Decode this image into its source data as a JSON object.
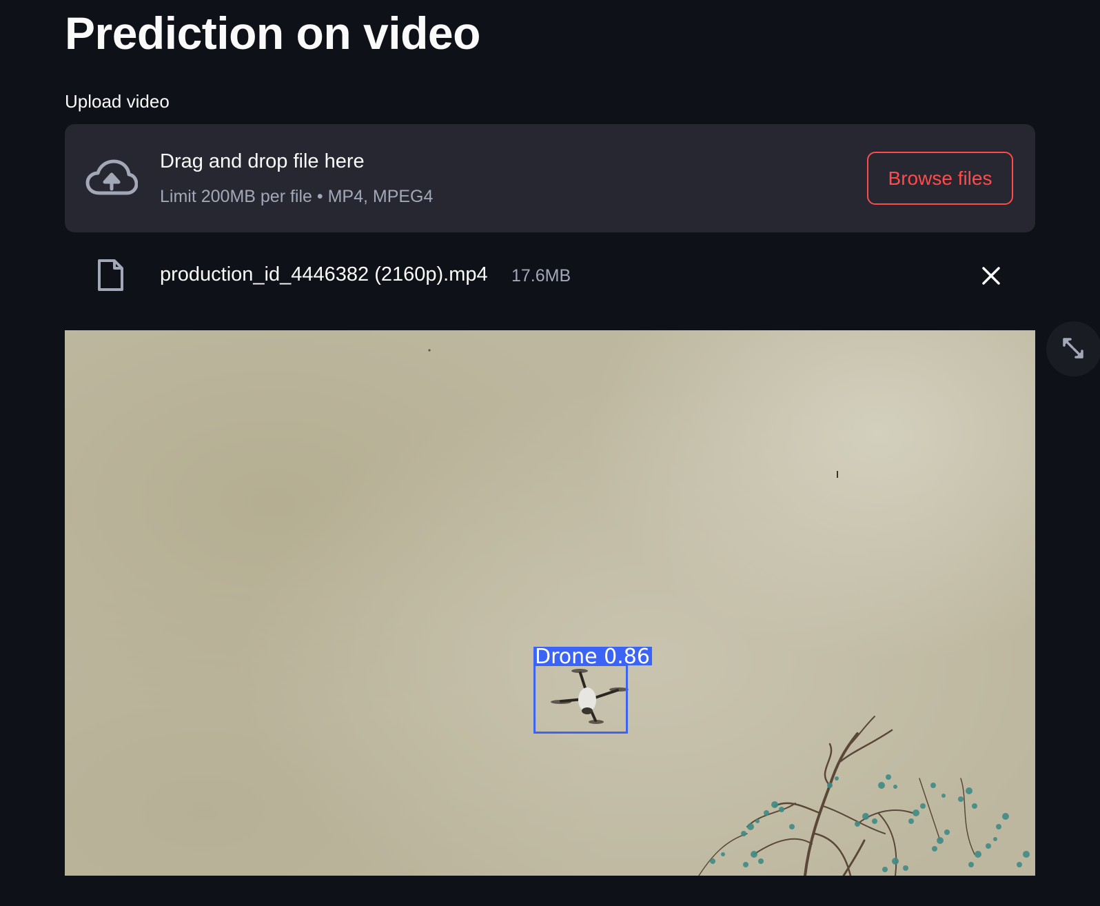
{
  "page": {
    "title": "Prediction on video"
  },
  "uploader": {
    "label": "Upload video",
    "dropzone_text": "Drag and drop file here",
    "limit_text": "Limit 200MB per file • MP4, MPEG4",
    "browse_button": "Browse files",
    "upload_icon": "cloud-upload-icon"
  },
  "uploaded_file": {
    "name": "production_id_4446382 (2160p).mp4",
    "size": "17.6MB",
    "file_icon": "file-icon",
    "remove_icon": "close-icon"
  },
  "video": {
    "detection_label": "Drone  0.86",
    "fullscreen_icon": "expand-icon"
  },
  "colors": {
    "background": "#0e1117",
    "dropzone": "#262730",
    "accent": "#ff4b4b",
    "bbox": "#3b63f5",
    "muted_text": "#a3a8b8"
  }
}
